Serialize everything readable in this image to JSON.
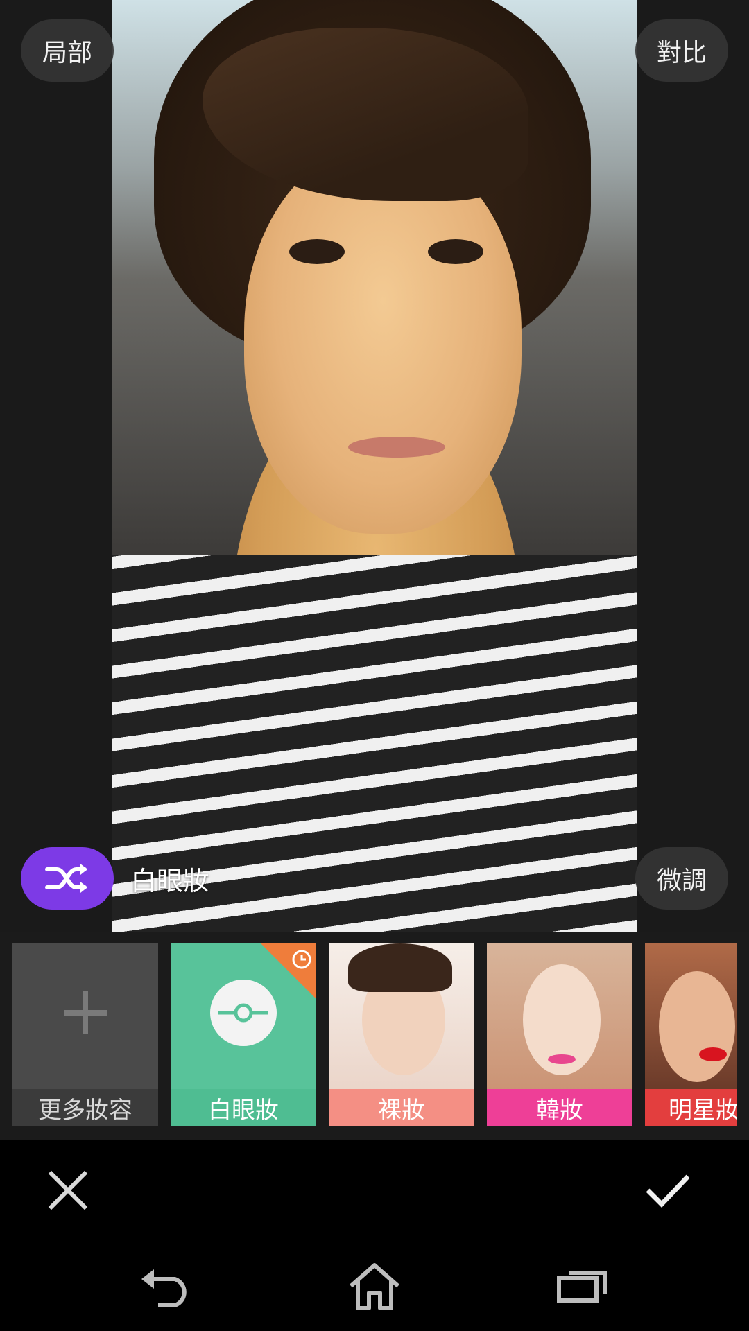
{
  "top_controls": {
    "partial_label": "局部",
    "compare_label": "對比"
  },
  "makeup": {
    "current_style": "白眼妝",
    "fine_tune_label": "微調"
  },
  "styles": [
    {
      "label": "更多妝容"
    },
    {
      "label": "白眼妝"
    },
    {
      "label": "裸妝"
    },
    {
      "label": "韓妝"
    },
    {
      "label": "明星妝"
    }
  ],
  "icons": {
    "shuffle": "shuffle-icon",
    "plus": "plus-icon",
    "clock": "clock-icon",
    "cancel": "close-icon",
    "confirm": "checkmark-icon",
    "back": "back-icon",
    "home": "home-icon",
    "recents": "recents-icon"
  },
  "colors": {
    "accent_purple": "#7d3ae6",
    "white_eye_green": "#58c39a",
    "nude_pink": "#f48f84",
    "korean_magenta": "#ee3f97",
    "star_red": "#e33e3e"
  }
}
